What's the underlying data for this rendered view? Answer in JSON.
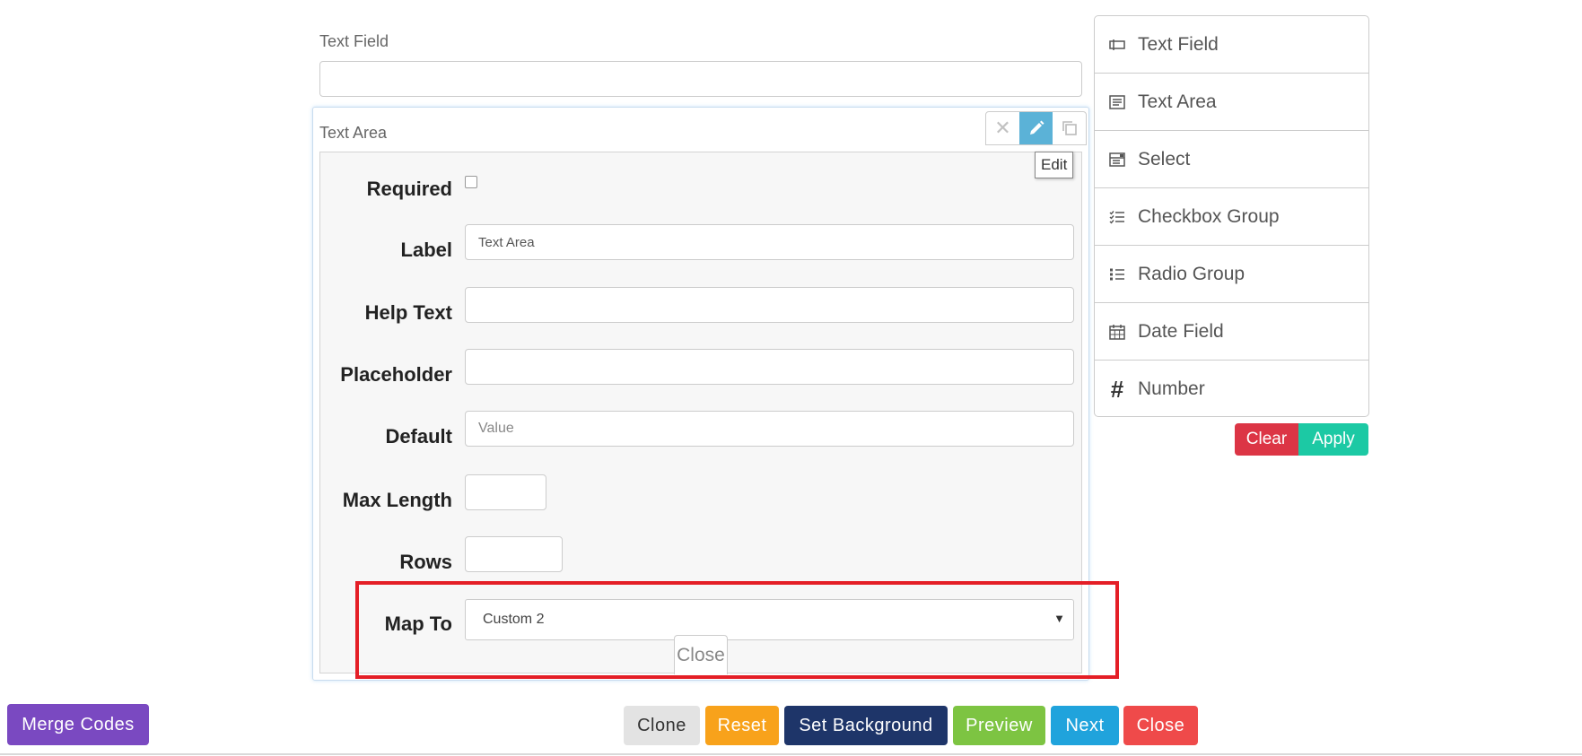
{
  "stage": {
    "text_field": {
      "label": "Text Field",
      "value": ""
    },
    "text_area": {
      "label": "Text Area",
      "actions": {
        "tooltip": "Edit"
      },
      "edit_panel": {
        "required": {
          "label": "Required",
          "checked": false
        },
        "label": {
          "label": "Label",
          "value": "Text Area"
        },
        "help_text": {
          "label": "Help Text",
          "value": ""
        },
        "placeholder": {
          "label": "Placeholder",
          "value": ""
        },
        "default": {
          "label": "Default",
          "placeholder": "Value"
        },
        "max_length": {
          "label": "Max Length",
          "value": ""
        },
        "rows": {
          "label": "Rows",
          "value": ""
        },
        "map_to": {
          "label": "Map To",
          "selected": "Custom 2"
        },
        "close_label": "Close"
      }
    }
  },
  "controls": {
    "items": [
      {
        "label": "Text Field",
        "icon": "text-field-icon"
      },
      {
        "label": "Text Area",
        "icon": "text-area-icon"
      },
      {
        "label": "Select",
        "icon": "select-icon"
      },
      {
        "label": "Checkbox Group",
        "icon": "checkbox-group-icon"
      },
      {
        "label": "Radio Group",
        "icon": "radio-group-icon"
      },
      {
        "label": "Date Field",
        "icon": "calendar-icon"
      },
      {
        "label": "Number",
        "icon": "hash-icon",
        "glyph": "#"
      }
    ],
    "clear_label": "Clear",
    "apply_label": "Apply"
  },
  "toolbar": {
    "merge_codes": "Merge Codes",
    "clone": "Clone",
    "reset": "Reset",
    "set_background": "Set Background",
    "preview": "Preview",
    "next": "Next",
    "close": "Close"
  },
  "colors": {
    "clear": "#dc3545",
    "apply": "#1cc9a4",
    "merge_codes": "#7a49c1",
    "clone": "#e3e3e3",
    "reset": "#f8a21b",
    "set_background": "#1e3569",
    "preview": "#7dc442",
    "next": "#20a3dc",
    "close": "#ef4a4a",
    "edit_action": "#5bb2d7",
    "highlight": "#e41e26"
  }
}
